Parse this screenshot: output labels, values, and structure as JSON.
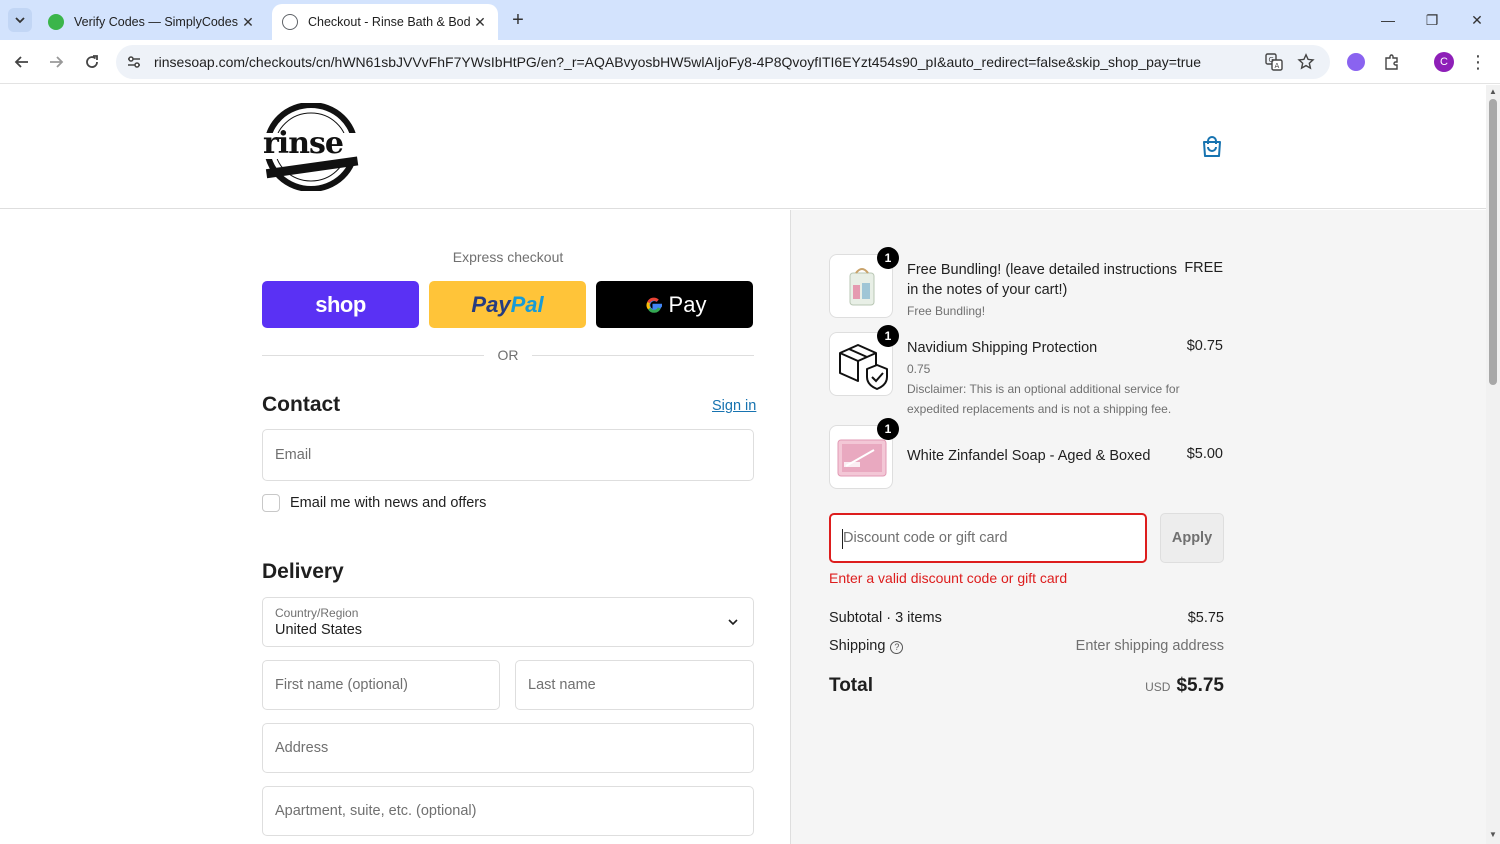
{
  "browser": {
    "tabs": [
      {
        "title": "Verify Codes — SimplyCodes",
        "active": false
      },
      {
        "title": "Checkout - Rinse Bath & Body",
        "active": true
      }
    ],
    "url": "rinsesoap.com/checkouts/cn/hWN61sbJVVvFhF7YWsIbHtPG/en?_r=AQABvyosbHW5wlAIjoFy8-4P8QvoyfITI6EYzt454s90_pI&auto_redirect=false&skip_shop_pay=true",
    "profile_initial": "C"
  },
  "header": {
    "logo_alt": "rinse bath & body co."
  },
  "express": {
    "title": "Express checkout",
    "shop_label": "shop",
    "paypal_label_1": "Pay",
    "paypal_label_2": "Pal",
    "gpay_label": "Pay",
    "or_label": "OR"
  },
  "contact": {
    "title": "Contact",
    "signin_label": "Sign in",
    "email_placeholder": "Email",
    "newsletter_label": "Email me with news and offers"
  },
  "delivery": {
    "title": "Delivery",
    "country_label": "Country/Region",
    "country_value": "United States",
    "first_name_placeholder": "First name (optional)",
    "last_name_placeholder": "Last name",
    "address_placeholder": "Address",
    "apartment_placeholder": "Apartment, suite, etc. (optional)"
  },
  "order": {
    "items": [
      {
        "qty": "1",
        "name": "Free Bundling! (leave detailed instructions in the notes of your cart!)",
        "variant": "Free Bundling!",
        "note": "",
        "price": "FREE"
      },
      {
        "qty": "1",
        "name": "Navidium Shipping Protection",
        "variant": "0.75",
        "note": "Disclaimer: This is an optional additional service for expedited replacements and is not a shipping fee.",
        "price": "$0.75"
      },
      {
        "qty": "1",
        "name": "White Zinfandel Soap - Aged & Boxed",
        "variant": "",
        "note": "",
        "price": "$5.00"
      }
    ],
    "discount_placeholder": "Discount code or gift card",
    "apply_label": "Apply",
    "error_text": "Enter a valid discount code or gift card",
    "subtotal_label": "Subtotal · 3 items",
    "subtotal_value": "$5.75",
    "shipping_label": "Shipping",
    "shipping_value": "Enter shipping address",
    "total_label": "Total",
    "total_currency": "USD",
    "total_value": "$5.75"
  }
}
